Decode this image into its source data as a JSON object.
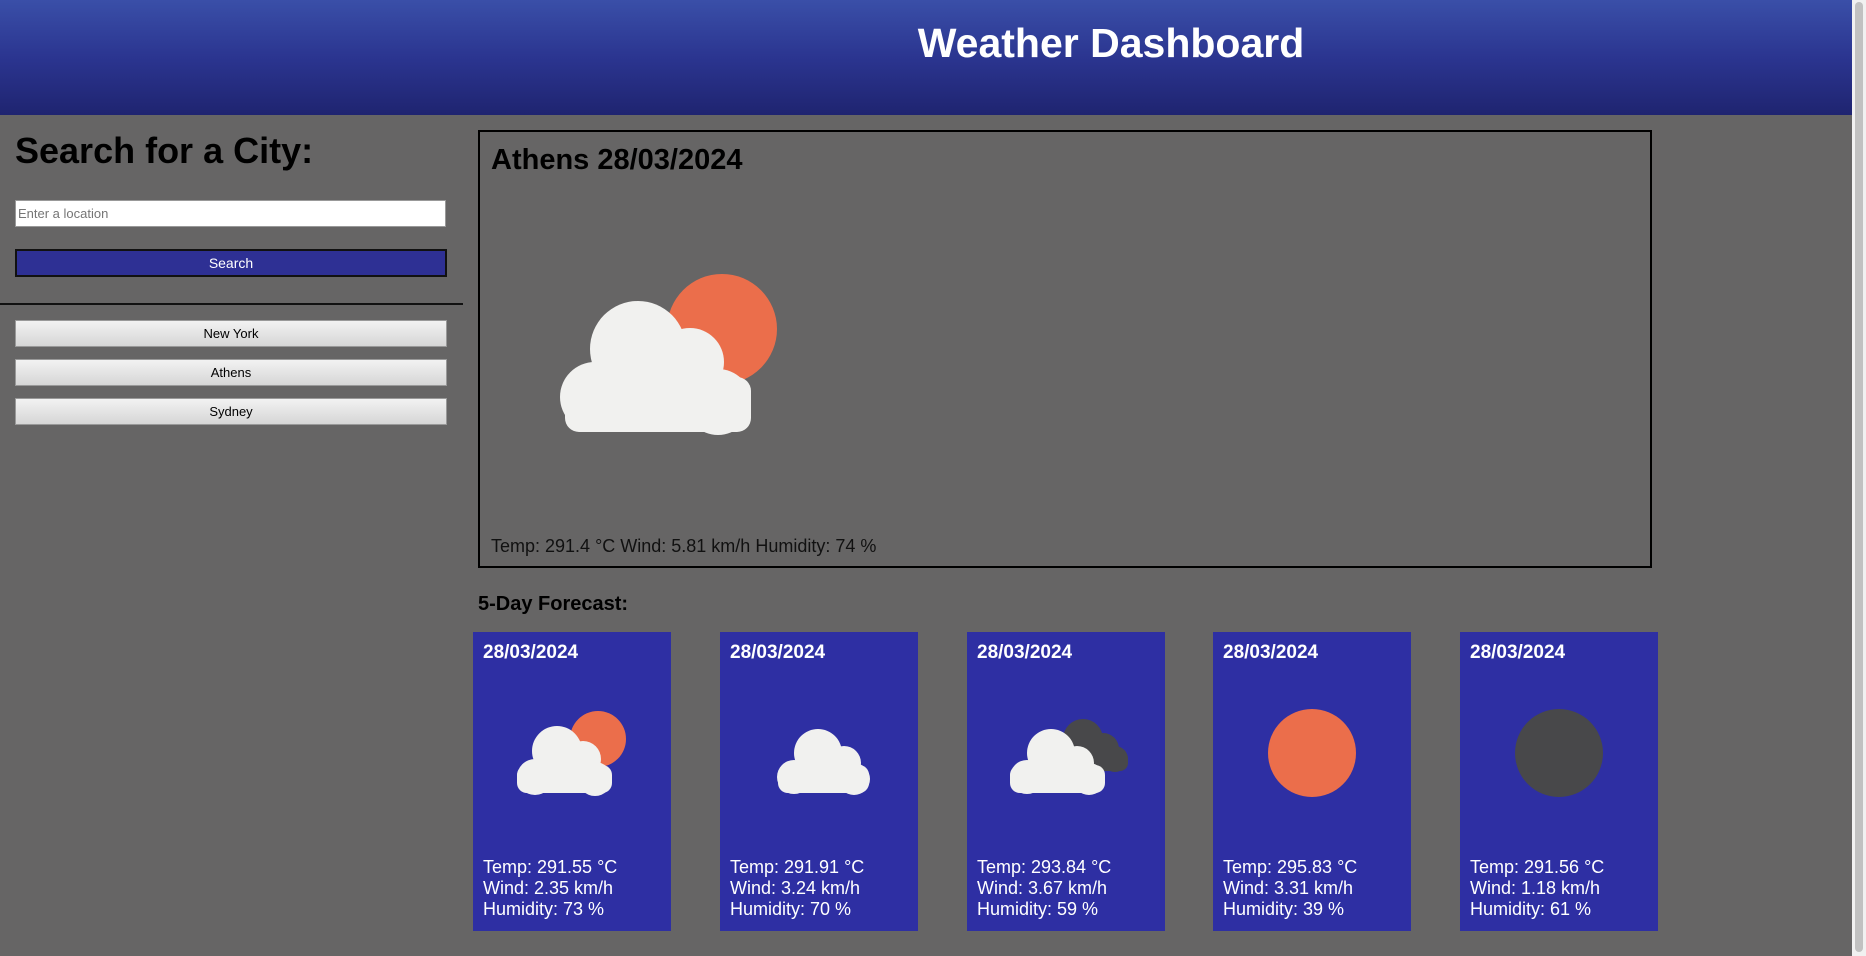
{
  "header": {
    "title": "Weather Dashboard"
  },
  "sidebar": {
    "heading": "Search for a City:",
    "search": {
      "placeholder": "Enter a location",
      "value": ""
    },
    "search_button": "Search",
    "history": [
      "New York",
      "Athens",
      "Sydney"
    ]
  },
  "current": {
    "title": "Athens 28/03/2024",
    "icon": "partly-cloudy-day-icon",
    "stats": "Temp: 291.4 °C Wind: 5.81 km/h Humidity: 74 %"
  },
  "forecast": {
    "title": "5-Day Forecast:",
    "days": [
      {
        "date": "28/03/2024",
        "icon": "partly-cloudy-day-icon",
        "temp": "Temp: 291.55 °C",
        "wind": "Wind: 2.35 km/h",
        "humidity": "Humidity: 73 %"
      },
      {
        "date": "28/03/2024",
        "icon": "cloud-icon",
        "temp": "Temp: 291.91 °C",
        "wind": "Wind: 3.24 km/h",
        "humidity": "Humidity: 70 %"
      },
      {
        "date": "28/03/2024",
        "icon": "broken-clouds-icon",
        "temp": "Temp: 293.84 °C",
        "wind": "Wind: 3.67 km/h",
        "humidity": "Humidity: 59 %"
      },
      {
        "date": "28/03/2024",
        "icon": "clear-sky-day-icon",
        "temp": "Temp: 295.83 °C",
        "wind": "Wind: 3.31 km/h",
        "humidity": "Humidity: 39 %"
      },
      {
        "date": "28/03/2024",
        "icon": "clear-sky-night-icon",
        "temp": "Temp: 291.56 °C",
        "wind": "Wind: 1.18 km/h",
        "humidity": "Humidity: 61 %"
      }
    ]
  },
  "colors": {
    "header_top": "#3a4fa8",
    "header_bottom": "#1f2470",
    "page_background": "#666565",
    "card_background": "#2e2fa3",
    "sun": "#eb6e4b",
    "cloud": "#f1f1ef",
    "dark_cloud": "#48484a"
  }
}
